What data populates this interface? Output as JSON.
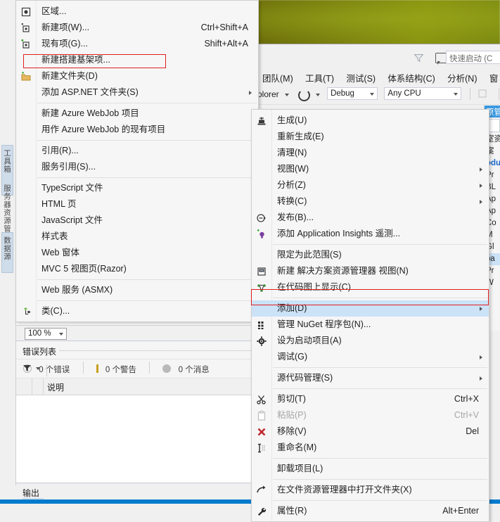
{
  "app": {
    "title": "Microsoft Visual Studio",
    "accent_blue": "#007acc",
    "highlight_blue": "#cbe2f7",
    "redbox_color": "#e02020"
  },
  "menubar": {
    "items": [
      {
        "label": "团队(M)"
      },
      {
        "label": "工具(T)"
      },
      {
        "label": "测试(S)"
      },
      {
        "label": "体系结构(C)"
      },
      {
        "label": "分析(N)"
      },
      {
        "label": "窗"
      }
    ]
  },
  "quick_launch": {
    "placeholder": "快速启动 (C",
    "funnel_icon": "funnel-icon",
    "feedback_icon": "feedback-icon"
  },
  "toolbar": {
    "explorer_label": "olorer",
    "refresh_icon": "refresh-icon",
    "configuration": "Debug",
    "platform": "Any CPU"
  },
  "editor": {
    "zoom_level": "100 %"
  },
  "error_list": {
    "title": "错误列表",
    "filter_icon": "funnel-icon",
    "errors": "0 个错误",
    "warnings": "0 个警告",
    "messages": "0 个消息",
    "column_description": "说明"
  },
  "output_pane": {
    "tab_label": "输出"
  },
  "solution_explorer": {
    "header": "原管",
    "rows": [
      {
        "text": "室资",
        "bold": false,
        "selected": false,
        "arrow": false
      },
      {
        "text": "案",
        "bold": false,
        "selected": false,
        "arrow": true
      },
      {
        "text": "odu",
        "bold": true,
        "selected": false,
        "arrow": true
      },
      {
        "text": "Pr",
        "bold": false,
        "selected": false,
        "arrow": true
      },
      {
        "text": "BL",
        "bold": false,
        "selected": false,
        "arrow": false
      },
      {
        "text": "Ap",
        "bold": false,
        "selected": false,
        "arrow": false
      },
      {
        "text": "Ap",
        "bold": false,
        "selected": false,
        "arrow": false
      },
      {
        "text": "Co",
        "bold": false,
        "selected": false,
        "arrow": false
      },
      {
        "text": "M",
        "bold": false,
        "selected": false,
        "arrow": false
      },
      {
        "text": "Gl",
        "bold": false,
        "selected": false,
        "arrow": false
      },
      {
        "text": "pa",
        "bold": false,
        "selected": true,
        "arrow": true
      },
      {
        "text": "Pr",
        "bold": false,
        "selected": false,
        "arrow": false
      },
      {
        "text": "W",
        "bold": false,
        "selected": false,
        "arrow": false
      }
    ]
  },
  "left_strip": {
    "tabs": [
      {
        "label": "工具箱"
      },
      {
        "label": "服务器资源管理器"
      },
      {
        "label": "数据源"
      }
    ]
  },
  "add_menu": {
    "name": "添加子菜单",
    "items": [
      {
        "type": "item",
        "label": "区域...",
        "accel": "",
        "icon": "region-icon",
        "submenu": false,
        "disabled": false,
        "highlighted": false
      },
      {
        "type": "item",
        "label": "新建项(W)...",
        "accel": "Ctrl+Shift+A",
        "icon": "new-item-icon",
        "submenu": false,
        "disabled": false,
        "highlighted": false
      },
      {
        "type": "item",
        "label": "现有项(G)...",
        "accel": "Shift+Alt+A",
        "icon": "existing-item-icon",
        "submenu": false,
        "disabled": false,
        "highlighted": false
      },
      {
        "type": "item",
        "label": "新建搭建基架项...",
        "accel": "",
        "icon": "",
        "submenu": false,
        "disabled": false,
        "highlighted": false
      },
      {
        "type": "item",
        "label": "新建文件夹(D)",
        "accel": "",
        "icon": "new-folder-icon",
        "submenu": false,
        "disabled": false,
        "highlighted": false
      },
      {
        "type": "item",
        "label": "添加 ASP.NET 文件夹(S)",
        "accel": "",
        "icon": "",
        "submenu": true,
        "disabled": false,
        "highlighted": false
      },
      {
        "type": "separator"
      },
      {
        "type": "item",
        "label": "新建 Azure WebJob 项目",
        "accel": "",
        "icon": "",
        "submenu": false,
        "disabled": false,
        "highlighted": false
      },
      {
        "type": "item",
        "label": "用作 Azure WebJob 的现有项目",
        "accel": "",
        "icon": "",
        "submenu": false,
        "disabled": false,
        "highlighted": false
      },
      {
        "type": "separator"
      },
      {
        "type": "item",
        "label": "引用(R)...",
        "accel": "",
        "icon": "",
        "submenu": false,
        "disabled": false,
        "highlighted": false
      },
      {
        "type": "item",
        "label": "服务引用(S)...",
        "accel": "",
        "icon": "",
        "submenu": false,
        "disabled": false,
        "highlighted": false
      },
      {
        "type": "separator"
      },
      {
        "type": "item",
        "label": "TypeScript 文件",
        "accel": "",
        "icon": "",
        "submenu": false,
        "disabled": false,
        "highlighted": false
      },
      {
        "type": "item",
        "label": "HTML 页",
        "accel": "",
        "icon": "",
        "submenu": false,
        "disabled": false,
        "highlighted": false
      },
      {
        "type": "item",
        "label": "JavaScript 文件",
        "accel": "",
        "icon": "",
        "submenu": false,
        "disabled": false,
        "highlighted": false
      },
      {
        "type": "item",
        "label": "样式表",
        "accel": "",
        "icon": "",
        "submenu": false,
        "disabled": false,
        "highlighted": false
      },
      {
        "type": "item",
        "label": "Web 窗体",
        "accel": "",
        "icon": "",
        "submenu": false,
        "disabled": false,
        "highlighted": false
      },
      {
        "type": "item",
        "label": "MVC 5 视图页(Razor)",
        "accel": "",
        "icon": "",
        "submenu": false,
        "disabled": false,
        "highlighted": false
      },
      {
        "type": "separator"
      },
      {
        "type": "item",
        "label": "Web 服务 (ASMX)",
        "accel": "",
        "icon": "",
        "submenu": false,
        "disabled": false,
        "highlighted": false
      },
      {
        "type": "separator"
      },
      {
        "type": "item",
        "label": "类(C)...",
        "accel": "",
        "icon": "class-icon",
        "submenu": false,
        "disabled": false,
        "highlighted": false
      }
    ]
  },
  "project_menu": {
    "name": "项目上下文菜单",
    "items": [
      {
        "type": "item",
        "label": "生成(U)",
        "accel": "",
        "icon": "build-icon",
        "submenu": false,
        "disabled": false,
        "highlighted": false
      },
      {
        "type": "item",
        "label": "重新生成(E)",
        "accel": "",
        "icon": "",
        "submenu": false,
        "disabled": false,
        "highlighted": false
      },
      {
        "type": "item",
        "label": "清理(N)",
        "accel": "",
        "icon": "",
        "submenu": false,
        "disabled": false,
        "highlighted": false
      },
      {
        "type": "item",
        "label": "视图(W)",
        "accel": "",
        "icon": "",
        "submenu": true,
        "disabled": false,
        "highlighted": false
      },
      {
        "type": "item",
        "label": "分析(Z)",
        "accel": "",
        "icon": "",
        "submenu": true,
        "disabled": false,
        "highlighted": false
      },
      {
        "type": "item",
        "label": "转换(C)",
        "accel": "",
        "icon": "",
        "submenu": true,
        "disabled": false,
        "highlighted": false
      },
      {
        "type": "item",
        "label": "发布(B)...",
        "accel": "",
        "icon": "publish-icon",
        "submenu": false,
        "disabled": false,
        "highlighted": false
      },
      {
        "type": "item",
        "label": "添加 Application Insights 遥测...",
        "accel": "",
        "icon": "insights-icon",
        "submenu": false,
        "disabled": false,
        "highlighted": false
      },
      {
        "type": "separator"
      },
      {
        "type": "item",
        "label": "限定为此范围(S)",
        "accel": "",
        "icon": "",
        "submenu": false,
        "disabled": false,
        "highlighted": false
      },
      {
        "type": "item",
        "label": "新建 解决方案资源管理器 视图(N)",
        "accel": "",
        "icon": "new-view-icon",
        "submenu": false,
        "disabled": false,
        "highlighted": false
      },
      {
        "type": "item",
        "label": "在代码图上显示(C)",
        "accel": "",
        "icon": "codemap-icon",
        "submenu": false,
        "disabled": false,
        "highlighted": false
      },
      {
        "type": "separator"
      },
      {
        "type": "item",
        "label": "添加(D)",
        "accel": "",
        "icon": "",
        "submenu": true,
        "disabled": false,
        "highlighted": true
      },
      {
        "type": "item",
        "label": "管理 NuGet 程序包(N)...",
        "accel": "",
        "icon": "nuget-icon",
        "submenu": false,
        "disabled": false,
        "highlighted": false
      },
      {
        "type": "item",
        "label": "设为启动项目(A)",
        "accel": "",
        "icon": "gear-icon",
        "submenu": false,
        "disabled": false,
        "highlighted": false
      },
      {
        "type": "item",
        "label": "调试(G)",
        "accel": "",
        "icon": "",
        "submenu": true,
        "disabled": false,
        "highlighted": false
      },
      {
        "type": "separator"
      },
      {
        "type": "item",
        "label": "源代码管理(S)",
        "accel": "",
        "icon": "",
        "submenu": true,
        "disabled": false,
        "highlighted": false
      },
      {
        "type": "separator"
      },
      {
        "type": "item",
        "label": "剪切(T)",
        "accel": "Ctrl+X",
        "icon": "scissors-icon",
        "submenu": false,
        "disabled": false,
        "highlighted": false
      },
      {
        "type": "item",
        "label": "粘贴(P)",
        "accel": "Ctrl+V",
        "icon": "paste-icon",
        "submenu": false,
        "disabled": true,
        "highlighted": false
      },
      {
        "type": "item",
        "label": "移除(V)",
        "accel": "Del",
        "icon": "remove-x-icon",
        "submenu": false,
        "disabled": false,
        "highlighted": false
      },
      {
        "type": "item",
        "label": "重命名(M)",
        "accel": "",
        "icon": "rename-icon",
        "submenu": false,
        "disabled": false,
        "highlighted": false
      },
      {
        "type": "separator"
      },
      {
        "type": "item",
        "label": "卸载项目(L)",
        "accel": "",
        "icon": "",
        "submenu": false,
        "disabled": false,
        "highlighted": false
      },
      {
        "type": "separator"
      },
      {
        "type": "item",
        "label": "在文件资源管理器中打开文件夹(X)",
        "accel": "",
        "icon": "open-folder-icon",
        "submenu": false,
        "disabled": false,
        "highlighted": false
      },
      {
        "type": "separator"
      },
      {
        "type": "item",
        "label": "属性(R)",
        "accel": "Alt+Enter",
        "icon": "wrench-icon",
        "submenu": false,
        "disabled": false,
        "highlighted": false
      }
    ]
  }
}
